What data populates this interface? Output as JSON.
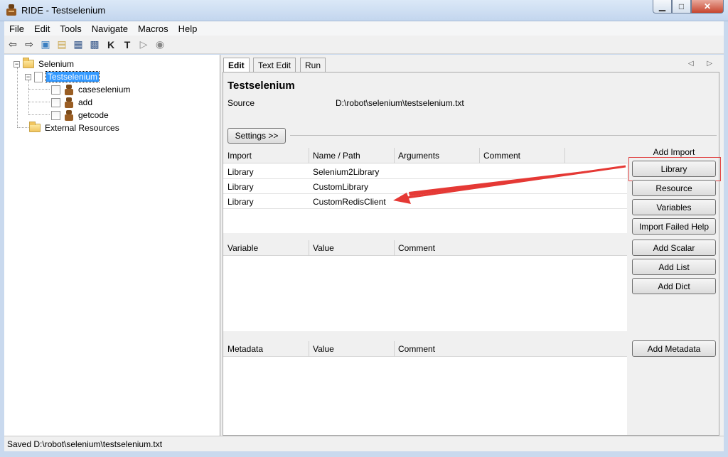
{
  "window": {
    "title": "RIDE - Testselenium",
    "app_icon": "robot-icon"
  },
  "window_controls": {
    "minimize": "▁",
    "maximize": "□",
    "close": "✕"
  },
  "menu": [
    "File",
    "Edit",
    "Tools",
    "Navigate",
    "Macros",
    "Help"
  ],
  "toolbar": {
    "icons": [
      "back-arrow-icon",
      "forward-arrow-icon",
      "open-test-suite-icon",
      "open-directory-icon",
      "save-icon",
      "save-all-icon",
      "keyword-search-icon",
      "test-search-icon",
      "run-icon",
      "stop-icon"
    ],
    "glyphs": [
      "⇦",
      "⇨",
      "▣",
      "▤",
      "▦",
      "▩",
      "K",
      "T",
      "▷",
      "◉"
    ]
  },
  "tree": {
    "root": {
      "label": "Selenium",
      "expander": "−"
    },
    "suite": {
      "label": "Testselenium",
      "expander": "−"
    },
    "tests": [
      {
        "label": "caseselenium"
      },
      {
        "label": "add"
      },
      {
        "label": "getcode"
      }
    ],
    "external": {
      "label": "External Resources"
    }
  },
  "tabs": [
    {
      "label": "Edit",
      "active": true
    },
    {
      "label": "Text Edit",
      "active": false
    },
    {
      "label": "Run",
      "active": false
    }
  ],
  "tab_nav": "◁ ▷",
  "editor": {
    "title": "Testselenium",
    "source_label": "Source",
    "source_value": "D:\\robot\\selenium\\testselenium.txt",
    "settings_button": "Settings >>"
  },
  "imports_table": {
    "headers": [
      "Import",
      "Name / Path",
      "Arguments",
      "Comment"
    ],
    "rows": [
      [
        "Library",
        "Selenium2Library",
        "",
        ""
      ],
      [
        "Library",
        "CustomLibrary",
        "",
        ""
      ],
      [
        "Library",
        "CustomRedisClient",
        "",
        ""
      ]
    ]
  },
  "variables_table": {
    "headers": [
      "Variable",
      "Value",
      "Comment"
    ]
  },
  "metadata_table": {
    "headers": [
      "Metadata",
      "Value",
      "Comment"
    ]
  },
  "side_buttons": {
    "add_import_label": "Add Import",
    "library": "Library",
    "resource": "Resource",
    "variables": "Variables",
    "import_failed_help": "Import Failed Help",
    "add_scalar": "Add Scalar",
    "add_list": "Add List",
    "add_dict": "Add Dict",
    "add_metadata": "Add Metadata"
  },
  "statusbar": {
    "text": "Saved D:\\robot\\selenium\\testselenium.txt"
  },
  "colors": {
    "selection": "#3399ff",
    "annotation": "#e53935",
    "titlebar": "#c3d6ee"
  }
}
